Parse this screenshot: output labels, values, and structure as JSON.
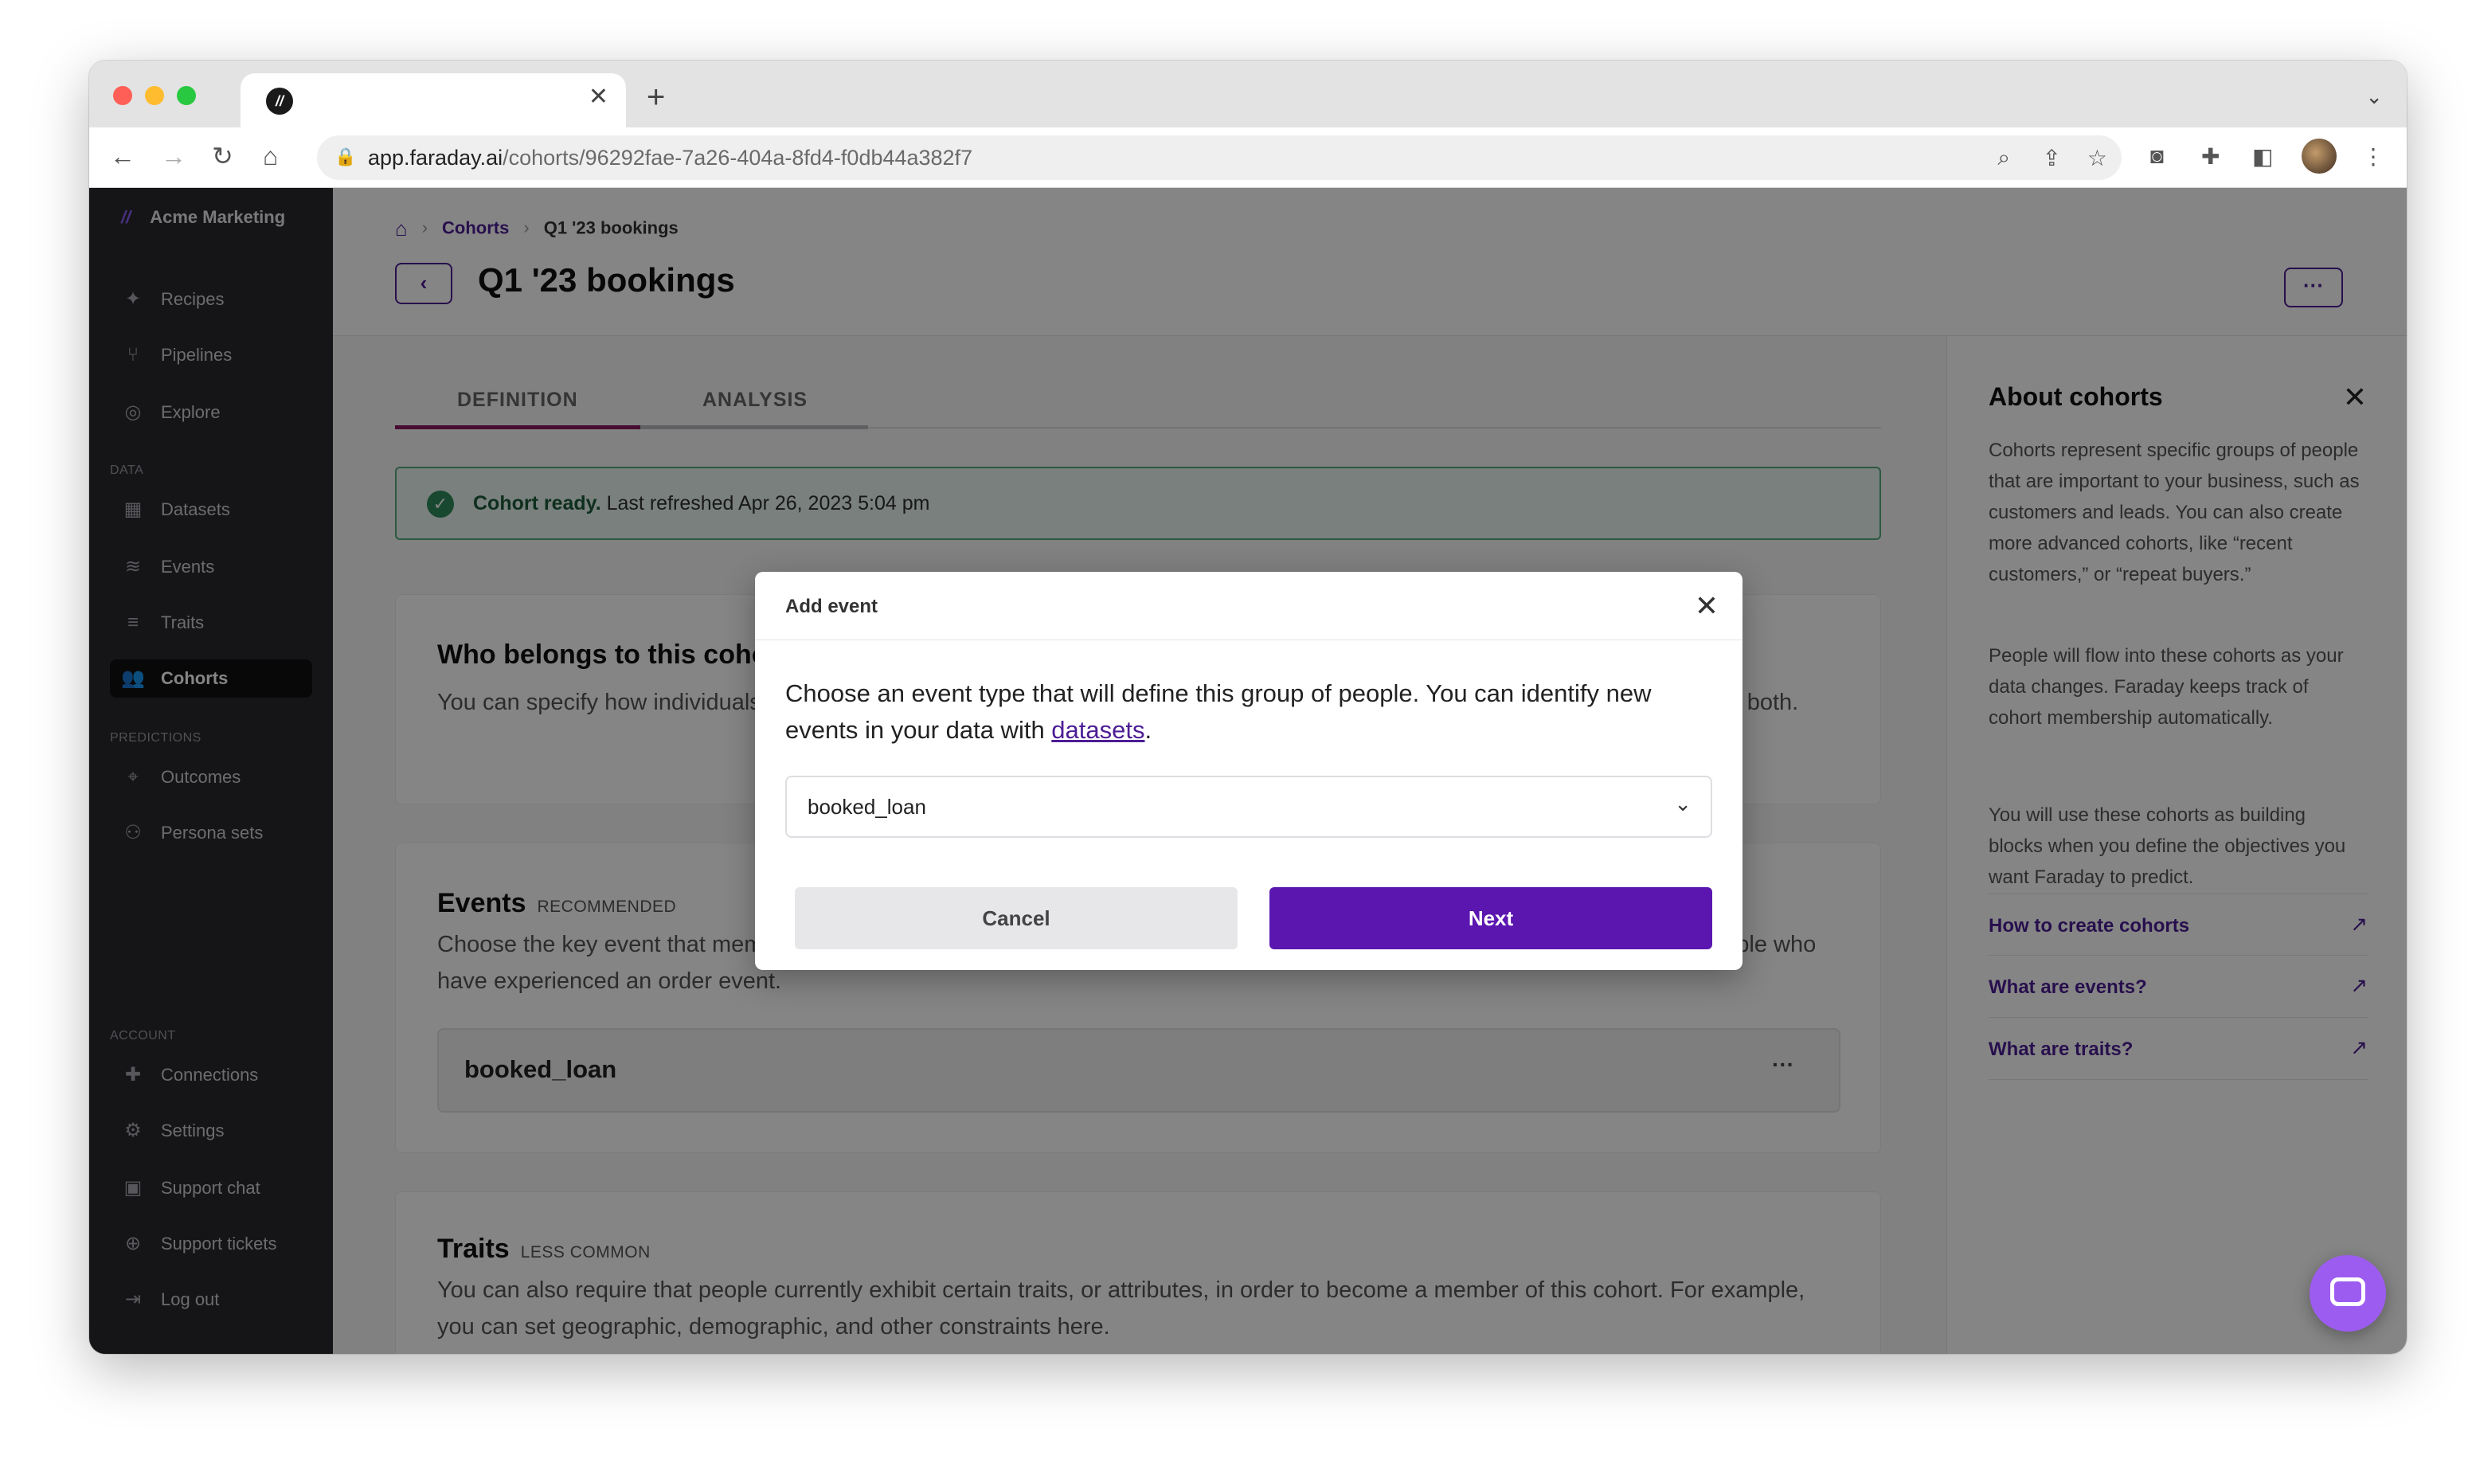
{
  "browser": {
    "tab_title": "",
    "url_host": "app.faraday.ai",
    "url_path": "/cohorts/96292fae-7a26-404a-8fd4-f0db44a382f7"
  },
  "sidebar": {
    "org_name": "Acme Marketing",
    "items": [
      {
        "label": "Recipes",
        "icon": "wand-icon"
      },
      {
        "label": "Pipelines",
        "icon": "fork-icon"
      },
      {
        "label": "Explore",
        "icon": "compass-icon"
      }
    ],
    "data_section": "DATA",
    "data_items": [
      {
        "label": "Datasets",
        "icon": "grid-icon"
      },
      {
        "label": "Events",
        "icon": "layers-icon"
      },
      {
        "label": "Traits",
        "icon": "filter-icon"
      },
      {
        "label": "Cohorts",
        "icon": "people-icon"
      }
    ],
    "predictions_section": "PREDICTIONS",
    "predictions_items": [
      {
        "label": "Outcomes",
        "icon": "target-icon"
      },
      {
        "label": "Persona sets",
        "icon": "personas-icon"
      }
    ],
    "account_section": "ACCOUNT",
    "account_items": [
      {
        "label": "Connections",
        "icon": "puzzle-icon"
      },
      {
        "label": "Settings",
        "icon": "gear-icon"
      },
      {
        "label": "Support chat",
        "icon": "chat-icon"
      },
      {
        "label": "Support tickets",
        "icon": "lifebuoy-icon"
      },
      {
        "label": "Log out",
        "icon": "logout-icon"
      }
    ]
  },
  "header": {
    "crumb_cohorts": "Cohorts",
    "crumb_current": "Q1 '23 bookings",
    "title": "Q1 '23 bookings"
  },
  "tabs": [
    "DEFINITION",
    "ANALYSIS"
  ],
  "status": {
    "strong": "Cohort ready.",
    "text": "Last refreshed Apr 26, 2023 5:04 pm"
  },
  "cards": {
    "who_title": "Who belongs to this cohort?",
    "who_text": "You can specify how individuals qualify for this cohort, such as the events they must have experienced, traits they must have, or both.",
    "events_title": "Events",
    "events_tag": "RECOMMENDED",
    "events_text": "Choose the key event that members of this cohort must have experienced. For example, you can define your customers as people who have experienced an order event.",
    "event_name": "booked_loan",
    "traits_title": "Traits",
    "traits_tag": "LESS COMMON",
    "traits_text": "You can also require that people currently exhibit certain traits, or attributes, in order to become a member of this cohort. For example, you can set geographic, demographic, and other constraints here."
  },
  "info_panel": {
    "title": "About cohorts",
    "para1": "Cohorts represent specific groups of people that are important to your business, such as customers and leads. You can also create more advanced cohorts, like “recent customers,” or “repeat buyers.”",
    "para2": "People will flow into these cohorts as your data changes. Faraday keeps track of cohort membership automatically.",
    "para3": "You will use these cohorts as building blocks when you define the objectives you want Faraday to predict.",
    "links": [
      "How to create cohorts",
      "What are events?",
      "What are traits?"
    ]
  },
  "modal": {
    "title": "Add event",
    "body_before": "Choose an event type that will define this group of people. You can identify new events in your data with ",
    "body_link": "datasets",
    "body_after": ".",
    "selected_event": "booked_loan",
    "cancel_label": "Cancel",
    "next_label": "Next"
  },
  "colors": {
    "brand": "#5b16b0",
    "sidebar_bg": "#2a2a2e",
    "success": "#2f8a5b"
  }
}
